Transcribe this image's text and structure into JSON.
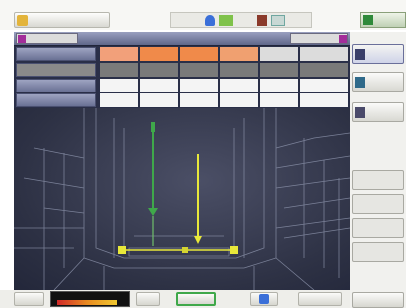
{
  "top": {
    "mode_tab": "",
    "status_icons": [
      {
        "name": "blue-status-icon",
        "color": "#3a6fd8"
      },
      {
        "name": "green-status-icon",
        "color": "#7fc24a"
      },
      {
        "name": "brown-status-icon",
        "color": "#8a3a2a"
      },
      {
        "name": "teal-status-icon",
        "color": "#6fa7a0"
      }
    ],
    "right_button": ""
  },
  "panel": {
    "title": "",
    "header_left": "",
    "header_right": ""
  },
  "table": {
    "header_row": {
      "label": "",
      "cells": [
        {
          "text": "",
          "color": "#f2a07a"
        },
        {
          "text": "",
          "color": "#f08a4a"
        },
        {
          "text": "",
          "color": "#f08a4a"
        },
        {
          "text": "",
          "color": "#f0a070"
        },
        {
          "text": "",
          "color": "#dcdcdc"
        },
        {
          "text": "",
          "color": "#dcdcdc"
        }
      ]
    },
    "value_row_1": {
      "label": "",
      "cells": [
        "",
        "",
        "",
        "",
        "",
        ""
      ]
    },
    "value_row_2": {
      "label": "",
      "cells": [
        "",
        "",
        "",
        "",
        "",
        ""
      ]
    },
    "value_row_3": {
      "label": "",
      "cells": [
        "",
        "",
        "",
        "",
        "",
        ""
      ]
    }
  },
  "right_panel": {
    "buttons": [
      {
        "label": "",
        "icon": "arm-selected-icon"
      },
      {
        "label": "",
        "icon": "arm-icon"
      },
      {
        "label": "",
        "icon": "tool-icon"
      },
      {
        "label": ""
      },
      {
        "label": ""
      },
      {
        "label": ""
      },
      {
        "label": ""
      }
    ]
  },
  "bottom": {
    "left_label": "",
    "gauge_label": "",
    "gauge_colors": [
      "#d02828",
      "#e88a20",
      "#f0c830"
    ],
    "btn_mid": "",
    "btn_selected": "",
    "btn_icon": "",
    "btn_r1": "",
    "btn_r2": ""
  },
  "colors": {
    "panel_bg": "#20253a",
    "header_bar": "#7a80a4",
    "accent_green": "#3fa84a",
    "accent_yellow": "#e8e83a",
    "accent_purple": "#a32d9a",
    "accent_orange": "#f08a4a"
  }
}
